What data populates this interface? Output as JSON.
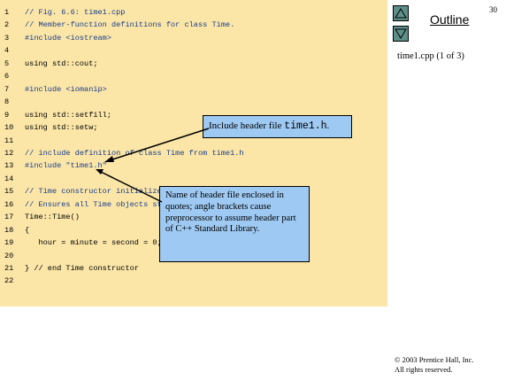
{
  "page_number": "30",
  "outline": {
    "title": "Outline",
    "file_label": "time1.cpp (1 of 3)"
  },
  "nav": {
    "up_label": "previous slide",
    "down_label": "next slide"
  },
  "code_lines": [
    {
      "num": "1",
      "code": "// Fig. 6.6: time1.cpp",
      "type": "comment"
    },
    {
      "num": "2",
      "code": "// Member-function definitions for class Time.",
      "type": "comment"
    },
    {
      "num": "3",
      "code": "#include <iostream>",
      "type": "directive"
    },
    {
      "num": "4",
      "code": "",
      "type": "plain"
    },
    {
      "num": "5",
      "code": "using std::cout;",
      "type": "plain"
    },
    {
      "num": "6",
      "code": "",
      "type": "plain"
    },
    {
      "num": "7",
      "code": "#include <iomanip>",
      "type": "directive"
    },
    {
      "num": "8",
      "code": "",
      "type": "plain"
    },
    {
      "num": "9",
      "code": "using std::setfill;",
      "type": "plain"
    },
    {
      "num": "10",
      "code": "using std::setw;",
      "type": "plain"
    },
    {
      "num": "11",
      "code": "",
      "type": "plain"
    },
    {
      "num": "12",
      "code": "// include definition of class Time from time1.h",
      "type": "comment"
    },
    {
      "num": "13",
      "code": "#include \"time1.h\"",
      "type": "directive"
    },
    {
      "num": "14",
      "code": "",
      "type": "plain"
    },
    {
      "num": "15",
      "code": "// Time constructor initializes each data member to zero.",
      "type": "comment"
    },
    {
      "num": "16",
      "code": "// Ensures all Time objects start in a consistent state.",
      "type": "comment"
    },
    {
      "num": "17",
      "code": "Time::Time()",
      "type": "plain"
    },
    {
      "num": "18",
      "code": "{",
      "type": "plain"
    },
    {
      "num": "19",
      "code": "   hour = minute = second = 0;",
      "type": "plain"
    },
    {
      "num": "20",
      "code": "",
      "type": "plain"
    },
    {
      "num": "21",
      "code": "} // end Time constructor",
      "type": "plain"
    },
    {
      "num": "22",
      "code": "",
      "type": "plain"
    }
  ],
  "callouts": {
    "header_include": {
      "prefix": "Include header file ",
      "code": "time1.h",
      "suffix": "."
    },
    "quotes_note": "Name of header file enclosed in quotes; angle brackets cause preprocessor to assume header part of C++ Standard Library."
  },
  "copyright": {
    "line1": "© 2003 Prentice Hall, Inc.",
    "line2": "All rights reserved."
  },
  "colors": {
    "code_bg": "#fbe6a8",
    "callout_bg": "#9ec9f2",
    "comment": "#1a3c8a",
    "nav_btn": "#5e8f8a"
  }
}
